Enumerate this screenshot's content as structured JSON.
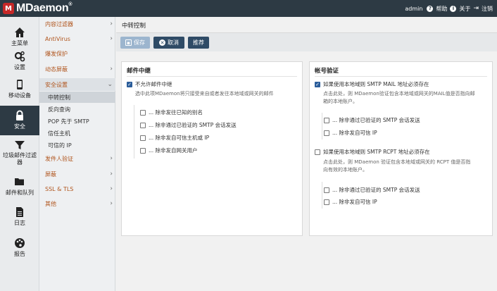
{
  "app": {
    "logo_mark": "M",
    "logo_text": "MDaemon",
    "logo_reg": "®"
  },
  "top_right": {
    "user": "admin",
    "help": "帮助",
    "about": "关于",
    "logout": "注销"
  },
  "rail": [
    {
      "label": "主菜单",
      "icon": "home-icon"
    },
    {
      "label": "设置",
      "icon": "gears-icon"
    },
    {
      "label": "移动设备",
      "icon": "mobile-icon"
    },
    {
      "label": "安全",
      "icon": "lock-icon",
      "active": true
    },
    {
      "label": "垃圾邮件过滤器",
      "icon": "filter-icon"
    },
    {
      "label": "邮件和队列",
      "icon": "folder-icon"
    },
    {
      "label": "日志",
      "icon": "document-icon"
    },
    {
      "label": "报告",
      "icon": "palette-icon"
    }
  ],
  "submenu": {
    "content_filter": "内容过滤器",
    "antivirus": "AntiVirus",
    "outbreak": "爆发保护",
    "dynamic_screen": "动态屏蔽",
    "security_settings": "安全设置",
    "relay": "中转控制",
    "reverse_lookup": "反向查询",
    "pop_before_smtp": "POP 先于 SMTP",
    "trusted_hosts": "信任主机",
    "trusted_ips": "可信的 IP",
    "sender_auth": "发件人验证",
    "screening": "屏蔽",
    "ssl_tls": "SSL & TLS",
    "other": "其他"
  },
  "main": {
    "title": "中转控制",
    "toolbar": {
      "save": "保存",
      "cancel": "取消",
      "push": "推荐"
    }
  },
  "relay_panel": {
    "title": "邮件中继",
    "no_relay": "不允许邮件中继",
    "desc": "选中此项MDaemon将只接受来自或者发往本地域或网关的邮件",
    "opt1": "... 除非发往已知的别名",
    "opt2": "... 除非通过已验证的 SMTP 会话发送",
    "opt3": "... 除非发自可信主机或 IP",
    "opt4": "... 除非发自网关用户"
  },
  "auth_panel": {
    "title": "帐号验证",
    "mail_from": "如果使用本地域则 SMTP MAIL 地址必须存在",
    "mail_desc1": "点击此处，则 MDaemon验证包含本地域或网关的MAIL值是否指向邮",
    "mail_desc2": "箱的本地账户。",
    "mail_opt1": "... 除非通过已验证的 SMTP 会话发送",
    "mail_opt2": "... 除非发自可信 IP",
    "rcpt_to": "如果使用本地域则 SMTP RCPT 地址必须存在",
    "rcpt_desc1": "点击此处，则 MDaemon 验证包含本地域或网关的 RCPT 值是否指",
    "rcpt_desc2": "向有效的本地账户。",
    "rcpt_opt1": "... 除非通过已验证的 SMTP 会话发送",
    "rcpt_opt2": "... 除非发自可信 IP"
  },
  "colors": {
    "topbar": "#2d3a44",
    "accent_link": "#b0541c",
    "button": "#2f4b66",
    "checkbox": "#2b5d9a"
  }
}
